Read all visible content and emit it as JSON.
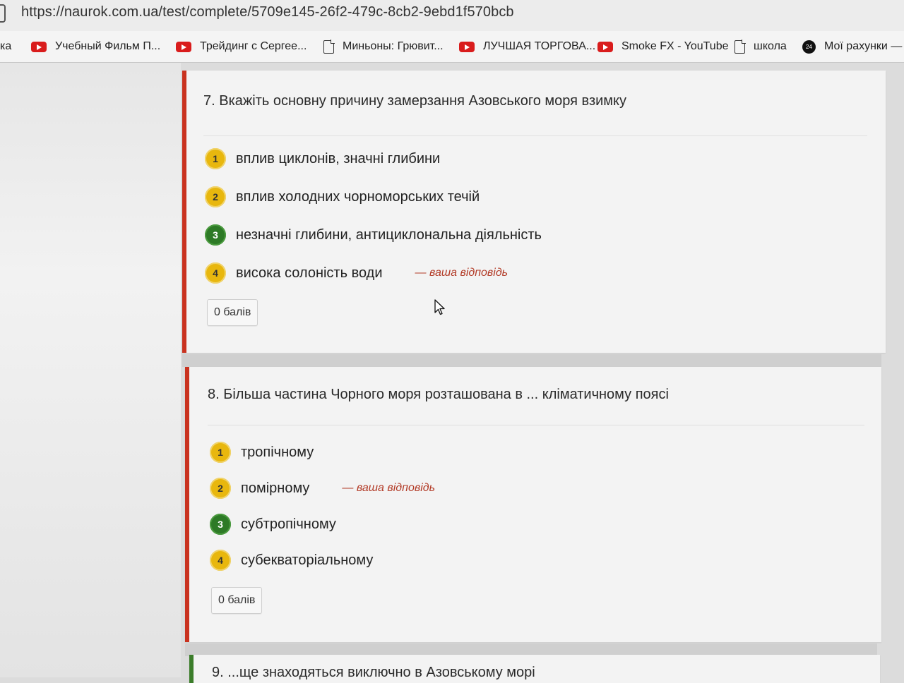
{
  "browser": {
    "url": "https://naurok.com.ua/test/complete/5709e145-26f2-479c-8cb2-9ebd1f570bcb",
    "bookmarks": [
      {
        "label": "ка",
        "icon": "none"
      },
      {
        "label": "Учебный Фильм П...",
        "icon": "youtube-icon"
      },
      {
        "label": "Трейдинг с Сергее...",
        "icon": "youtube-icon"
      },
      {
        "label": "Миньоны: Грювит...",
        "icon": "page-icon"
      },
      {
        "label": "ЛУЧШАЯ ТОРГОВА...",
        "icon": "youtube-icon"
      },
      {
        "label": "Smoke FX - YouTube",
        "icon": "youtube-icon"
      },
      {
        "label": "школа",
        "icon": "page-icon"
      },
      {
        "label": "Мої рахунки — Г",
        "icon": "account-icon"
      }
    ]
  },
  "colors": {
    "wrong_border": "#c9321f",
    "correct_border": "#3b7d2a",
    "badge_yellow": "#e8b70e",
    "badge_green": "#2d7a26",
    "your_answer": "#b23a26"
  },
  "questions": [
    {
      "title": "7. Вкажіть основну причину замерзання Азовського моря взимку",
      "options": [
        {
          "number": "1",
          "text": "вплив циклонів, значні глибини",
          "correct": false
        },
        {
          "number": "2",
          "text": "вплив холодних чорноморських течій",
          "correct": false
        },
        {
          "number": "3",
          "text": "незначні глибини, антициклональна діяльність",
          "correct": true
        },
        {
          "number": "4",
          "text": "висока солоність води",
          "correct": false,
          "your_answer": "— ваша відповідь"
        }
      ],
      "score": "0 балів"
    },
    {
      "title": "8. Більша частина Чорного моря розташована в ... кліматичному поясі",
      "options": [
        {
          "number": "1",
          "text": "тропічному",
          "correct": false
        },
        {
          "number": "2",
          "text": "помірному",
          "correct": false,
          "your_answer": "— ваша відповідь"
        },
        {
          "number": "3",
          "text": "субтропічному",
          "correct": true
        },
        {
          "number": "4",
          "text": "субекваторіальному",
          "correct": false
        }
      ],
      "score": "0 балів"
    },
    {
      "title": "9. ...ще знаходяться виключно в Азовському морі"
    }
  ]
}
